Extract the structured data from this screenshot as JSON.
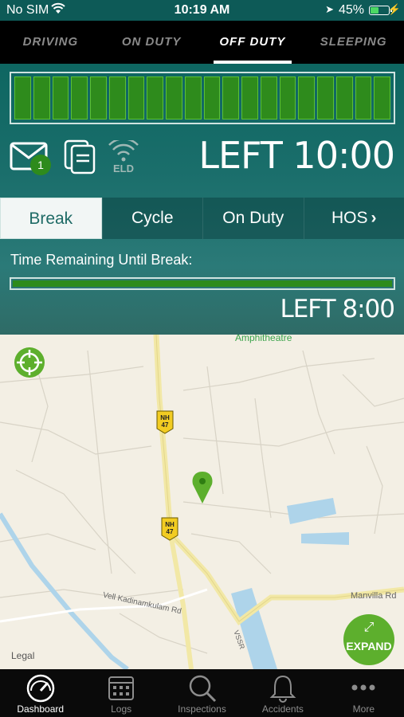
{
  "status_bar": {
    "carrier": "No SIM",
    "time": "10:19 AM",
    "battery": "45%"
  },
  "duty_tabs": [
    {
      "label": "Driving",
      "active": false
    },
    {
      "label": "On Duty",
      "active": false
    },
    {
      "label": "Off Duty",
      "active": true
    },
    {
      "label": "Sleeping",
      "active": false
    }
  ],
  "dashboard": {
    "message_count": "1",
    "eld_label": "ELD",
    "left_total": "LEFT 10:00",
    "progress_segments": 20
  },
  "sub_tabs": [
    {
      "label": "Break",
      "active": true
    },
    {
      "label": "Cycle",
      "active": false
    },
    {
      "label": "On Duty",
      "active": false
    },
    {
      "label": "HOS",
      "active": false
    }
  ],
  "break_panel": {
    "label": "Time Remaining Until Break:",
    "progress": 1.0,
    "left": "LEFT 8:00"
  },
  "map": {
    "amphitheatre_label": "Amphitheatre",
    "highway_badges": [
      "NH 47",
      "NH 47"
    ],
    "road_labels": [
      "Vell Kadinamkulam Rd",
      "Manvilla Rd",
      "VSSR"
    ],
    "legal": "Legal",
    "expand_label": "EXPAND"
  },
  "bottom_nav": [
    {
      "label": "Dashboard",
      "icon": "gauge-icon",
      "active": true
    },
    {
      "label": "Logs",
      "icon": "calendar-icon",
      "active": false
    },
    {
      "label": "Inspections",
      "icon": "search-icon",
      "active": false
    },
    {
      "label": "Accidents",
      "icon": "bell-icon",
      "active": false
    },
    {
      "label": "More",
      "icon": "more-dots-icon",
      "active": false
    }
  ],
  "colors": {
    "accent_green": "#5daf2d",
    "teal": "#0e6661",
    "bar_green": "#2e8b1c"
  }
}
